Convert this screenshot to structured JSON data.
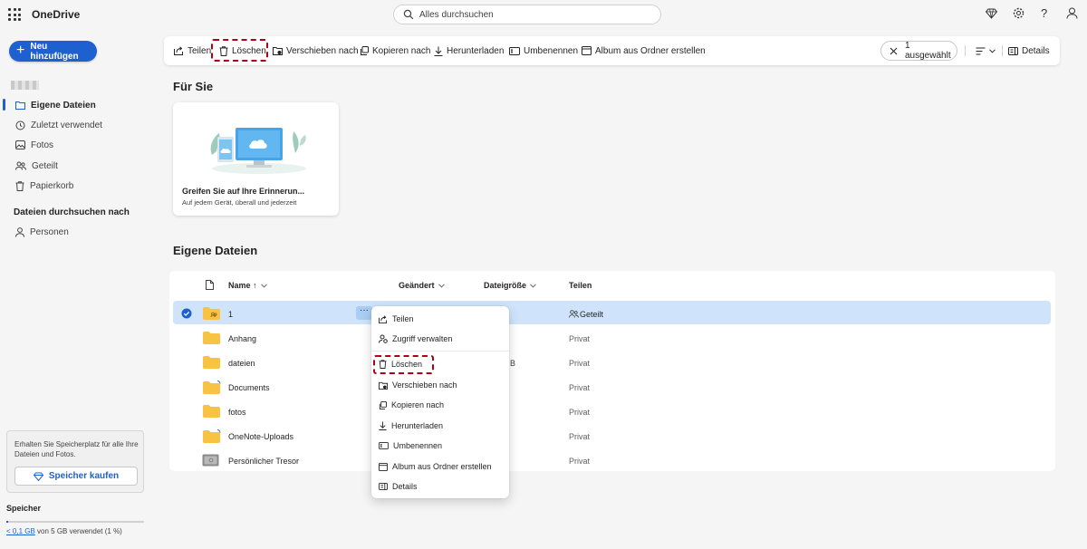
{
  "app": {
    "title": "OneDrive"
  },
  "search": {
    "placeholder": "Alles durchsuchen"
  },
  "topbar": {
    "icons": [
      "diamond-icon",
      "settings-icon",
      "help-icon",
      "account-icon"
    ]
  },
  "sidebar": {
    "new_button": "Neu hinzufügen",
    "items": [
      {
        "label": "Eigene Dateien",
        "icon": "folder-icon",
        "active": true
      },
      {
        "label": "Zuletzt verwendet",
        "icon": "history-icon"
      },
      {
        "label": "Fotos",
        "icon": "image-icon"
      },
      {
        "label": "Geteilt",
        "icon": "people-icon"
      },
      {
        "label": "Papierkorb",
        "icon": "trash-icon"
      }
    ],
    "browse_heading": "Dateien durchsuchen nach",
    "browse_items": [
      {
        "label": "Personen",
        "icon": "person-icon"
      }
    ],
    "storage_promo": "Erhalten Sie Speicherplatz für alle Ihre Dateien und Fotos.",
    "buy_button": "Speicher kaufen",
    "storage_label": "Speicher",
    "storage_used_link": "< 0,1 GB",
    "storage_used_rest": " von 5 GB verwendet (1 %)",
    "storage_fraction": 0.01
  },
  "toolbar": {
    "share": "Teilen",
    "delete": "Löschen",
    "move": "Verschieben nach",
    "copy": "Kopieren nach",
    "download": "Herunterladen",
    "rename": "Umbenennen",
    "album": "Album aus Ordner erstellen",
    "selected": "1 ausgewählt",
    "details": "Details"
  },
  "for_you": {
    "heading": "Für Sie",
    "card_title": "Greifen Sie auf Ihre Erinnerun...",
    "card_subtitle": "Auf jedem Gerät, überall und jederzeit"
  },
  "files": {
    "heading": "Eigene Dateien",
    "columns": {
      "name": "Name ↑",
      "modified": "Geändert",
      "size": "Dateigröße",
      "share": "Teilen"
    },
    "rows": [
      {
        "name": "1",
        "sharing": "Geteilt",
        "selected": true,
        "type": "shared-folder"
      },
      {
        "name": "Anhang",
        "sharing": "Privat",
        "type": "folder"
      },
      {
        "name": "dateien",
        "sharing": "Privat",
        "type": "folder",
        "size_fragment": "B"
      },
      {
        "name": "Documents",
        "sharing": "Privat",
        "type": "folder-synced"
      },
      {
        "name": "fotos",
        "sharing": "Privat",
        "type": "folder"
      },
      {
        "name": "OneNote-Uploads",
        "sharing": "Privat",
        "type": "folder-synced"
      },
      {
        "name": "Persönlicher Tresor",
        "sharing": "Privat",
        "type": "vault"
      }
    ]
  },
  "context_menu": {
    "items": [
      {
        "label": "Teilen",
        "icon": "share-icon"
      },
      {
        "label": "Zugriff verwalten",
        "icon": "manage-access-icon"
      },
      {
        "label": "Löschen",
        "icon": "trash-icon"
      },
      {
        "label": "Verschieben nach",
        "icon": "move-icon"
      },
      {
        "label": "Kopieren nach",
        "icon": "copy-icon"
      },
      {
        "label": "Herunterladen",
        "icon": "download-icon"
      },
      {
        "label": "Umbenennen",
        "icon": "rename-icon"
      },
      {
        "label": "Album aus Ordner erstellen",
        "icon": "album-icon"
      },
      {
        "label": "Details",
        "icon": "details-icon"
      }
    ]
  },
  "colors": {
    "accent": "#1f60d0",
    "selection": "#cfe4fa",
    "highlight_box": "#b00017",
    "folder": "#f8c343"
  }
}
